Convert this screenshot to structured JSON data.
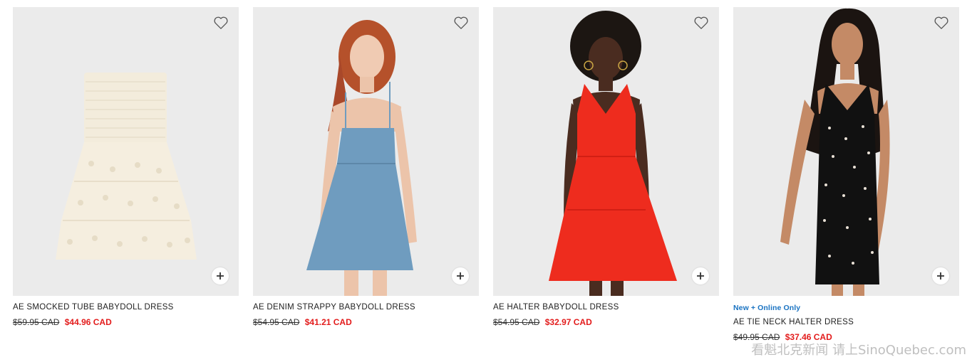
{
  "products": [
    {
      "name": "AE SMOCKED TUBE BABYDOLL DRESS",
      "badge": "",
      "was_price": "$59.95 CAD",
      "sale_price": "$44.96 CAD",
      "image": "cream-eyelet-tube-dress-flatlay",
      "favorite_icon": "heart-outline-icon",
      "add_icon": "plus-icon"
    },
    {
      "name": "AE DENIM STRAPPY BABYDOLL DRESS",
      "badge": "",
      "was_price": "$54.95 CAD",
      "sale_price": "$41.21 CAD",
      "image": "model-blue-denim-dress",
      "favorite_icon": "heart-outline-icon",
      "add_icon": "plus-icon"
    },
    {
      "name": "AE HALTER BABYDOLL DRESS",
      "badge": "",
      "was_price": "$54.95 CAD",
      "sale_price": "$32.97 CAD",
      "image": "model-red-halter-dress",
      "favorite_icon": "heart-outline-icon",
      "add_icon": "plus-icon"
    },
    {
      "name": "AE TIE NECK HALTER DRESS",
      "badge": "New + Online Only",
      "was_price": "$49.95 CAD",
      "sale_price": "$37.46 CAD",
      "image": "model-black-floral-halter-dress",
      "favorite_icon": "heart-outline-icon",
      "add_icon": "plus-icon"
    }
  ],
  "watermark": "看魁北克新闻 请上SinoQuebec.com",
  "colors": {
    "sale": "#e31c1c",
    "badge": "#1a73c2",
    "image_bg": "#ebebeb",
    "text": "#222222"
  }
}
